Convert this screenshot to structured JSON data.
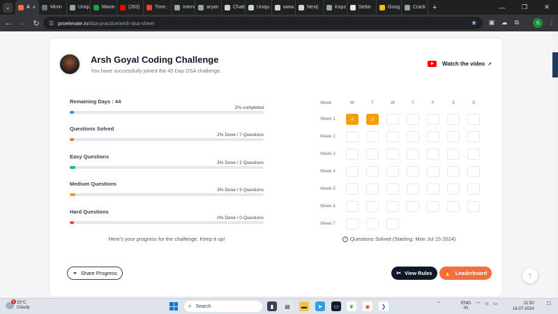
{
  "browser": {
    "tabs": [
      {
        "label": "A",
        "color": "#f46d43",
        "active": true
      },
      {
        "label": "Minin",
        "color": "#6b7280"
      },
      {
        "label": "Uniqu",
        "color": "#9ca3af"
      },
      {
        "label": "Maxin",
        "color": "#16a34a"
      },
      {
        "label": "(263)",
        "color": "#ff0000"
      },
      {
        "label": "Time :",
        "color": "#ff3b30"
      },
      {
        "label": "Interv",
        "color": "#9ca3af"
      },
      {
        "label": "aryan",
        "color": "#9ca3af"
      },
      {
        "label": "ChatG",
        "color": "#d1d5db"
      },
      {
        "label": "Uniqu",
        "color": "#d1d5db"
      },
      {
        "label": "www.",
        "color": "#d1d5db"
      },
      {
        "label": "Nextj",
        "color": "#d1d5db"
      },
      {
        "label": "Kopz",
        "color": "#9ca3af"
      },
      {
        "label": "Settin",
        "color": "#e5e7eb"
      },
      {
        "label": "Goog",
        "color": "#fbbc04"
      },
      {
        "label": "Crack",
        "color": "#9ca3af"
      }
    ],
    "url_domain": "proelevate.in",
    "url_path": "/dsa-practice/arsh-dsa-sheet",
    "profile_initial": "S"
  },
  "header": {
    "title": "Arsh Goyal Coding Challenge",
    "subtitle": "You have successfully joined the 45 Day DSA challenge.",
    "watch_label": "Watch the video"
  },
  "progress": [
    {
      "label": "Remaining Days : 44",
      "status": "2% completed",
      "percent": 2,
      "color": "#3b82f6"
    },
    {
      "label": "Questions Solved",
      "status": "2% Done / 7 Questions",
      "percent": 2,
      "color": "#f46d43"
    },
    {
      "label": "Easy Questions",
      "status": "3% Done / 2 Questions",
      "percent": 3,
      "color": "#10b981"
    },
    {
      "label": "Medium Questions",
      "status": "3% Done / 5 Questions",
      "percent": 3,
      "color": "#f59e0b"
    },
    {
      "label": "Hard Questions",
      "status": "0% Done / 0 Questions",
      "percent": 0,
      "color": "#ef4444"
    }
  ],
  "progress_footnote": "Here's your progress for the challenge. Keep it up!",
  "calendar": {
    "week_header": "Week",
    "days": [
      "M",
      "T",
      "W",
      "T",
      "F",
      "S",
      "S"
    ],
    "weeks": [
      "Week 1",
      "Week 2",
      "Week 3",
      "Week 4",
      "Week 5",
      "Week 6",
      "Week 7"
    ],
    "solved": {
      "0-0": "4",
      "0-1": "3"
    },
    "last_week_days": 3,
    "note": "Questions Solved (Starting: Mon Jul 15 2024)"
  },
  "actions": {
    "share_label": "Share Progress",
    "rules_label": "View Rules",
    "leaderboard_label": "Leaderboard"
  },
  "taskbar": {
    "temp": "25°C",
    "condition": "Cloudy",
    "weather_badge": "1",
    "search_placeholder": "Search",
    "lang_top": "ENG",
    "lang_bottom": "IN",
    "time": "21:50",
    "date": "16-07-2024"
  },
  "colors": {
    "accent": "#f46d43",
    "solved_cell": "#f59e0b",
    "dark_button": "#111827"
  }
}
